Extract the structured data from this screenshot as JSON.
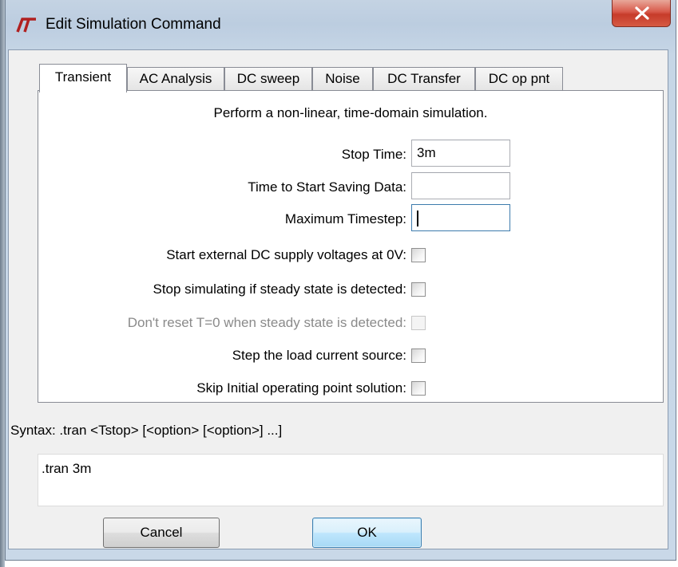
{
  "window": {
    "title": "Edit Simulation Command"
  },
  "tabs": [
    {
      "label": "Transient"
    },
    {
      "label": "AC Analysis"
    },
    {
      "label": "DC sweep"
    },
    {
      "label": "Noise"
    },
    {
      "label": "DC Transfer"
    },
    {
      "label": "DC op pnt"
    }
  ],
  "transient": {
    "description": "Perform a non-linear, time-domain simulation.",
    "stop_time": {
      "label": "Stop Time:",
      "value": "3m"
    },
    "start_saving": {
      "label": "Time to Start Saving Data:",
      "value": ""
    },
    "max_timestep": {
      "label": "Maximum Timestep:",
      "value": ""
    },
    "options": [
      {
        "label": "Start external DC supply voltages at 0V:",
        "checked": false,
        "enabled": true
      },
      {
        "label": "Stop simulating if steady state is detected:",
        "checked": false,
        "enabled": true
      },
      {
        "label": "Don't reset T=0 when steady state is detected:",
        "checked": false,
        "enabled": false
      },
      {
        "label": "Step the load current source:",
        "checked": false,
        "enabled": true
      },
      {
        "label": "Skip Initial operating point solution:",
        "checked": false,
        "enabled": true
      }
    ]
  },
  "syntax": "Syntax:  .tran <Tstop> [<option> [<option>] ...]",
  "command_text": ".tran 3m",
  "buttons": {
    "cancel": "Cancel",
    "ok": "OK"
  },
  "colors": {
    "title_bar": "#bccde0",
    "close_button": "#c63b2a",
    "logo": "#b02020",
    "default_button_border": "#3c7fb1"
  },
  "icons": {
    "app": "ltspice-logo-icon",
    "close": "close-icon"
  }
}
